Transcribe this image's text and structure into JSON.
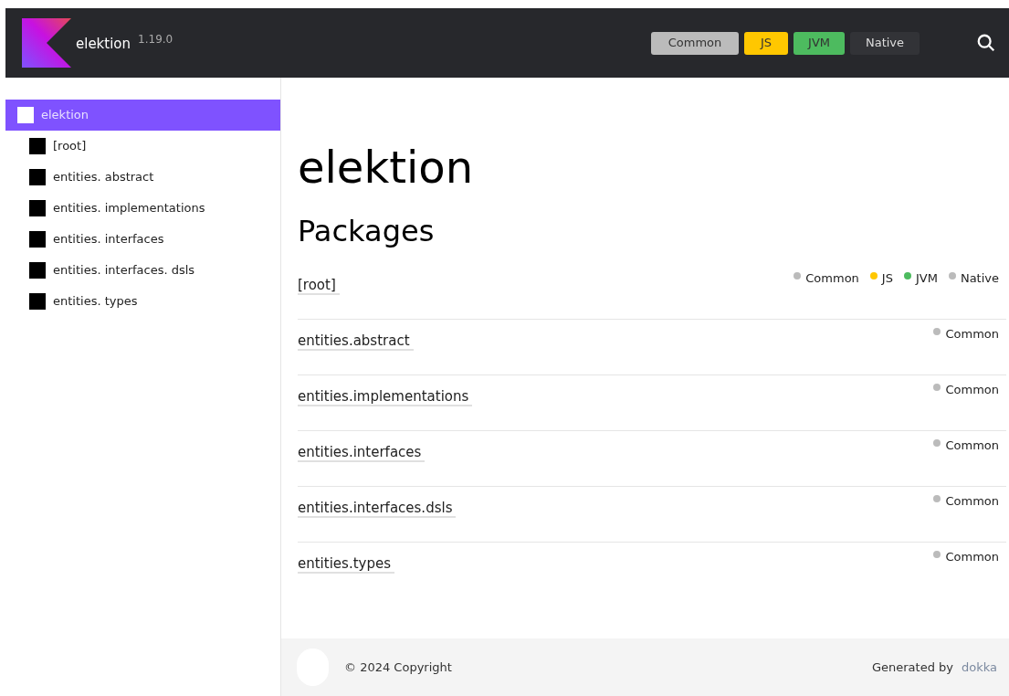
{
  "header": {
    "title": "elektion",
    "version": "1.19.0",
    "platforms": [
      {
        "label": "Common",
        "color": "#bbbbbb",
        "selected": true
      },
      {
        "label": "JS",
        "color": "#ffc700",
        "selected": true
      },
      {
        "label": "JVM",
        "color": "#4dbb5f",
        "selected": true
      },
      {
        "label": "Native",
        "selected": false
      }
    ]
  },
  "sidebar": {
    "items": [
      {
        "label": "elektion",
        "selected": true,
        "children": [
          {
            "label": "[root]",
            "selected": false
          },
          {
            "label": "entities. abstract",
            "selected": false
          },
          {
            "label": "entities. implementations",
            "selected": false
          },
          {
            "label": "entities. interfaces",
            "selected": false
          },
          {
            "label": "entities. interfaces. dsls",
            "selected": false
          },
          {
            "label": "entities. types",
            "selected": false
          }
        ]
      }
    ]
  },
  "main": {
    "title": "elektion",
    "section": "Packages",
    "packages": [
      {
        "name": "[root]",
        "platforms": [
          {
            "label": "Common",
            "color": "#bbbbbb"
          },
          {
            "label": "JS",
            "color": "#ffc700"
          },
          {
            "label": "JVM",
            "color": "#4dbb5f"
          },
          {
            "label": "Native",
            "color": "#bbbbbb"
          }
        ]
      },
      {
        "name": "entities.abstract",
        "platforms": [
          {
            "label": "Common",
            "color": "#bbbbbb"
          }
        ]
      },
      {
        "name": "entities.implementations",
        "platforms": [
          {
            "label": "Common",
            "color": "#bbbbbb"
          }
        ]
      },
      {
        "name": "entities.interfaces",
        "platforms": [
          {
            "label": "Common",
            "color": "#bbbbbb"
          }
        ]
      },
      {
        "name": "entities.interfaces.dsls",
        "platforms": [
          {
            "label": "Common",
            "color": "#bbbbbb"
          }
        ]
      },
      {
        "name": "entities.types",
        "platforms": [
          {
            "label": "Common",
            "color": "#bbbbbb"
          }
        ]
      }
    ]
  },
  "footer": {
    "copyright": "© 2024 Copyright",
    "generated_by": "Generated by",
    "generator": "dokka"
  }
}
